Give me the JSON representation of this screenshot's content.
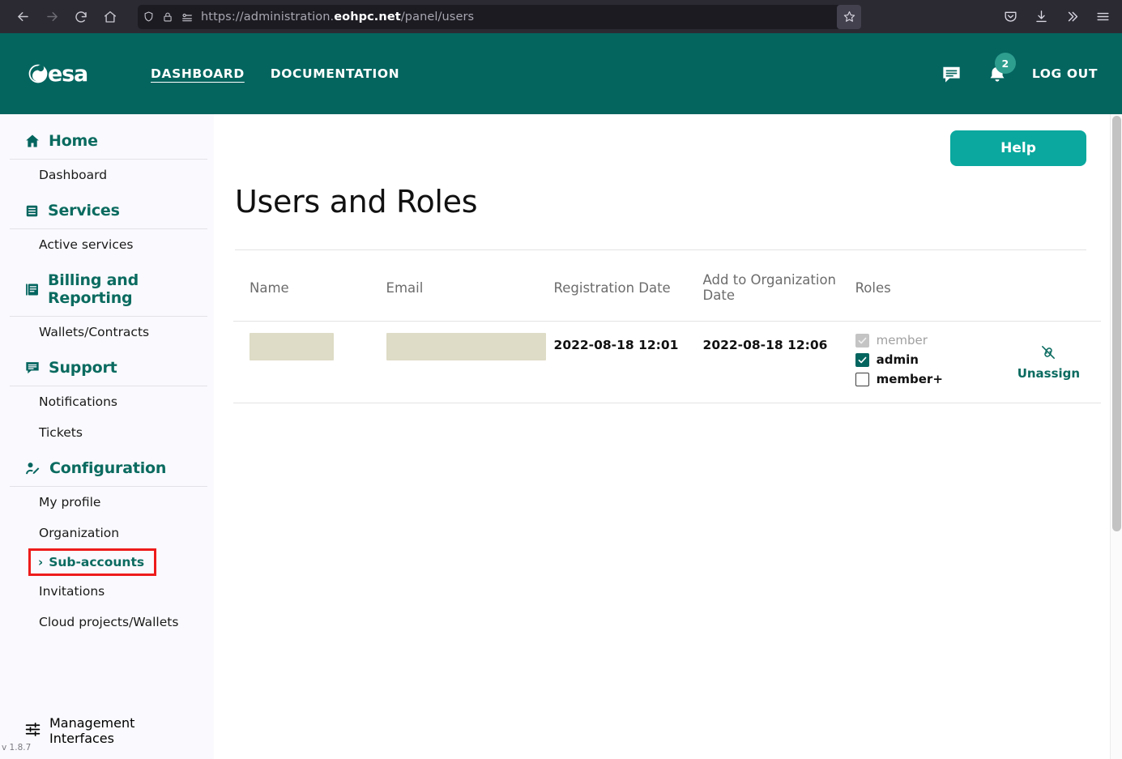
{
  "browser": {
    "back_icon": "back-arrow-icon",
    "forward_icon": "forward-arrow-icon",
    "reload_icon": "reload-icon",
    "home_icon": "home-icon",
    "shield_icon": "shield-icon",
    "lock_icon": "lock-icon",
    "permissions_icon": "permissions-icon",
    "url_prefix": "https://administration.",
    "url_domain": "eohpc.net",
    "url_suffix": "/panel/users",
    "url_full": "https://administration.eohpc.net/panel/users",
    "bookmark_icon": "star-icon",
    "pocket_icon": "pocket-icon",
    "downloads_icon": "download-icon",
    "overflow_icon": "chevrons-right-icon",
    "menu_icon": "hamburger-menu-icon"
  },
  "header": {
    "logo_text": "esa",
    "nav": [
      {
        "label": "DASHBOARD",
        "active": true
      },
      {
        "label": "DOCUMENTATION",
        "active": false
      }
    ],
    "messages_icon": "message-icon",
    "notifications_icon": "bell-icon",
    "notification_count": "2",
    "logout_label": "LOG OUT",
    "bg_color": "#04655f",
    "badge_color": "#2e9e8f"
  },
  "sidebar": {
    "sections": [
      {
        "label": "Home",
        "icon": "home-icon",
        "items": [
          {
            "label": "Dashboard",
            "highlighted": false
          }
        ]
      },
      {
        "label": "Services",
        "icon": "list-icon",
        "items": [
          {
            "label": "Active services",
            "highlighted": false
          }
        ]
      },
      {
        "label": "Billing and Reporting",
        "icon": "book-icon",
        "items": [
          {
            "label": "Wallets/Contracts",
            "highlighted": false
          }
        ]
      },
      {
        "label": "Support",
        "icon": "chat-icon",
        "items": [
          {
            "label": "Notifications",
            "highlighted": false
          },
          {
            "label": "Tickets",
            "highlighted": false
          }
        ]
      },
      {
        "label": "Configuration",
        "icon": "user-settings-icon",
        "items": [
          {
            "label": "My profile",
            "highlighted": false
          },
          {
            "label": "Organization",
            "highlighted": false
          },
          {
            "label": "Sub-accounts",
            "highlighted": true,
            "chevron": "›"
          },
          {
            "label": "Invitations",
            "highlighted": false
          },
          {
            "label": "Cloud projects/Wallets",
            "highlighted": false
          }
        ]
      }
    ],
    "bottom_section": {
      "label": "Management Interfaces",
      "icon": "sliders-icon"
    },
    "version": "v 1.8.7",
    "accent_color": "#0b6b60",
    "highlight_border_color": "#ee1c1c",
    "bg_color": "#faf9fd"
  },
  "main": {
    "help_label": "Help",
    "help_color": "#0aa89e",
    "page_title": "Users and Roles",
    "table": {
      "columns": [
        "Name",
        "Email",
        "Registration Date",
        "Add to Organization Date",
        "Roles",
        ""
      ],
      "rows": [
        {
          "name": "",
          "email": "",
          "registration_date": "2022-08-18 12:01",
          "add_to_organization_date": "2022-08-18 12:06",
          "roles": [
            {
              "label": "member",
              "checked": true,
              "disabled": true
            },
            {
              "label": "admin",
              "checked": true,
              "disabled": false
            },
            {
              "label": "member+",
              "checked": false,
              "disabled": false
            }
          ],
          "action_label": "Unassign",
          "action_icon": "unlink-icon"
        }
      ],
      "redacted_color": "#dedbc6"
    }
  }
}
